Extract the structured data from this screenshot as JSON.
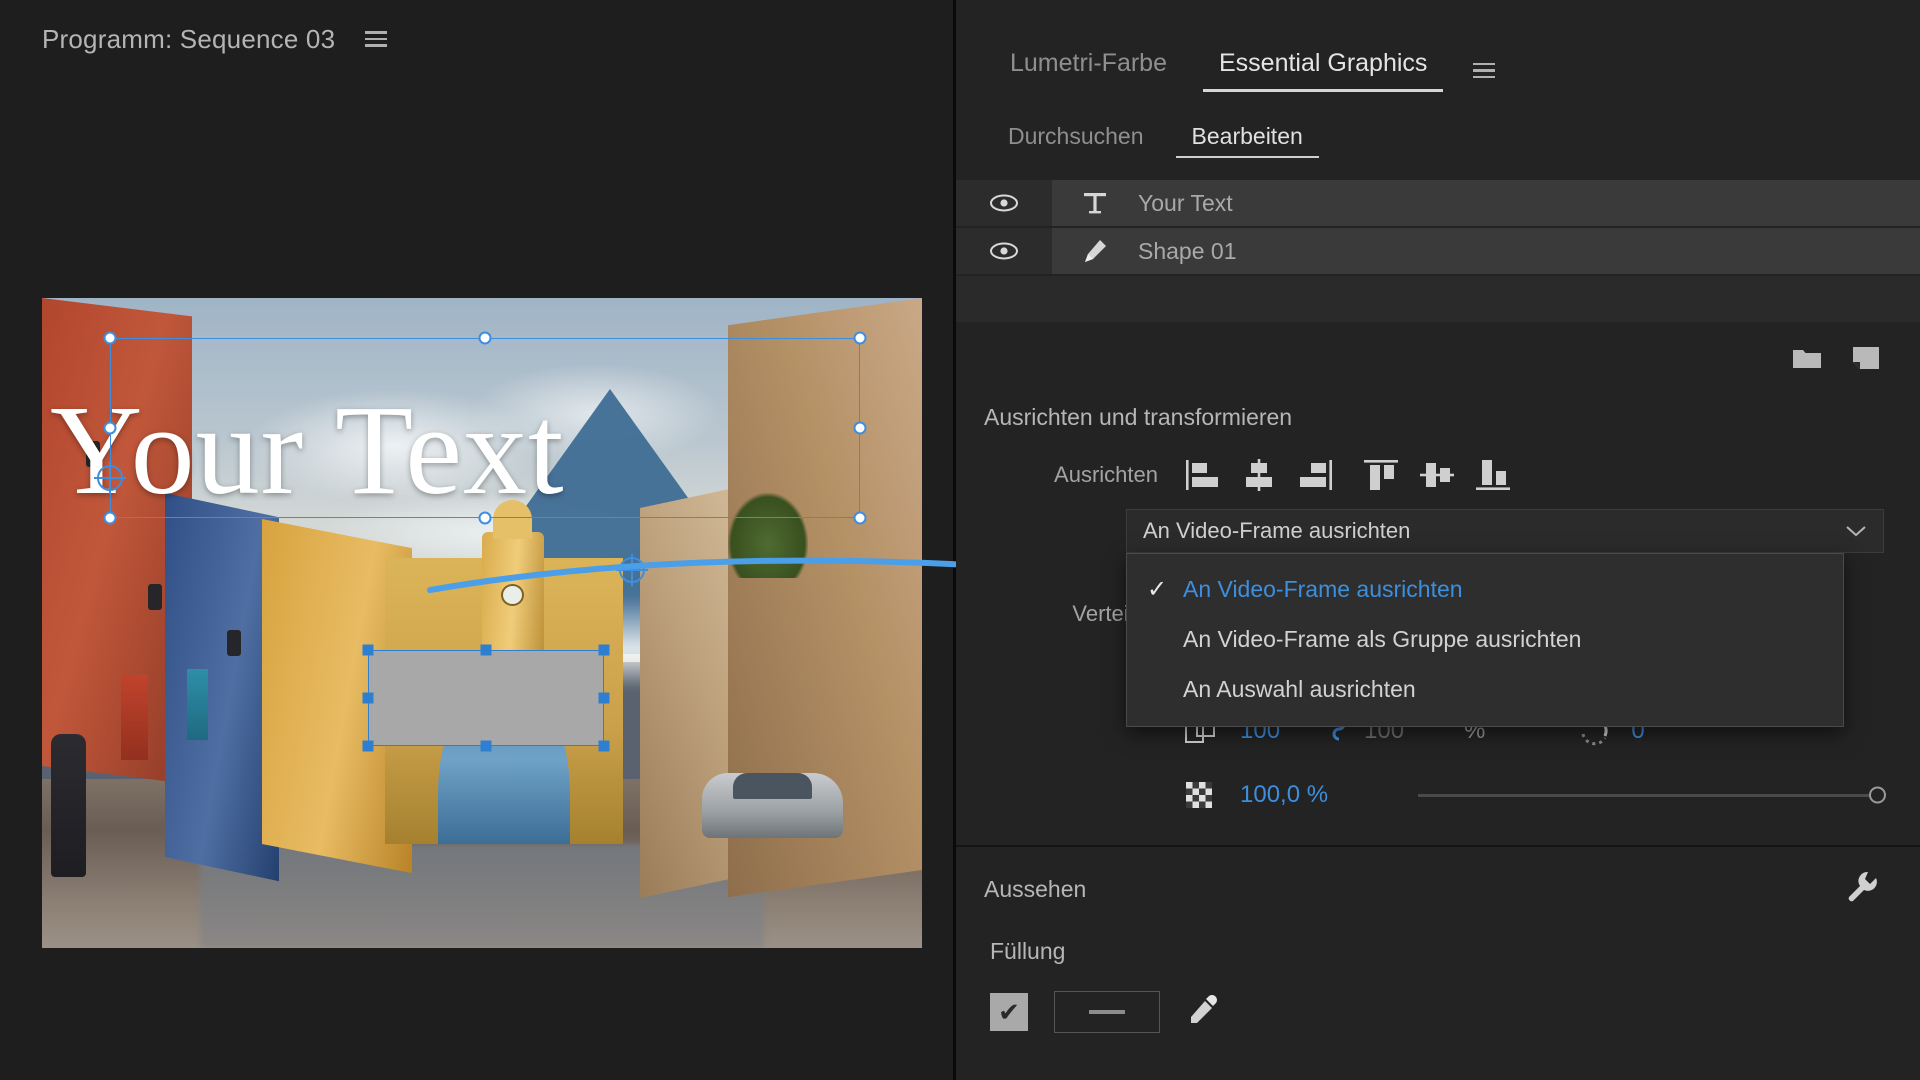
{
  "program": {
    "title": "Programm: Sequence 03",
    "menu_icon": "hamburger-icon",
    "overlay_text": "Your Text"
  },
  "panel": {
    "tabs": [
      {
        "label": "Lumetri-Farbe",
        "active": false
      },
      {
        "label": "Essential Graphics",
        "active": true
      }
    ],
    "menu_icon": "hamburger-icon",
    "subtabs": [
      {
        "label": "Durchsuchen",
        "active": false
      },
      {
        "label": "Bearbeiten",
        "active": true
      }
    ]
  },
  "layers": [
    {
      "name": "Your Text",
      "type": "text",
      "visible": true
    },
    {
      "name": "Shape 01",
      "type": "shape",
      "visible": true
    }
  ],
  "layer_tools": [
    {
      "icon": "folder-icon"
    },
    {
      "icon": "new-layer-icon"
    }
  ],
  "align_section": {
    "title": "Ausrichten und transformieren",
    "align_label": "Ausrichten",
    "align_buttons": [
      "align-left-icon",
      "align-center-horizontal-icon",
      "align-right-icon",
      "align-top-icon",
      "align-center-vertical-icon",
      "align-bottom-icon"
    ],
    "dropdown": {
      "value": "An Video-Frame ausrichten",
      "open": true,
      "options": [
        {
          "label": "An Video-Frame ausrichten",
          "checked": true
        },
        {
          "label": "An Video-Frame als Gruppe ausrichten",
          "checked": false
        },
        {
          "label": "An Auswahl ausrichten",
          "checked": false
        }
      ]
    },
    "distribute_label": "Verteilen",
    "position": {
      "icon": "move-icon",
      "x": "—",
      "y": ","
    },
    "scale": {
      "icon": "scale-icon",
      "width": "100",
      "height": "100",
      "unit": "%",
      "linked": true
    },
    "rotation": {
      "icon": "rotation-icon",
      "value": "0"
    },
    "opacity": {
      "icon": "opacity-icon",
      "value": "100,0 %"
    }
  },
  "appearance": {
    "title": "Aussehen",
    "settings_icon": "wrench-icon",
    "fill_label": "Füllung",
    "fill_enabled": true,
    "fill_swatch": "—",
    "eyedropper_icon": "eyedropper-icon"
  },
  "colors": {
    "accent_blue": "#3d8fdd",
    "selection_blue": "#3e8ede",
    "panel_bg": "#232323",
    "program_bg": "#1e1e1e"
  }
}
